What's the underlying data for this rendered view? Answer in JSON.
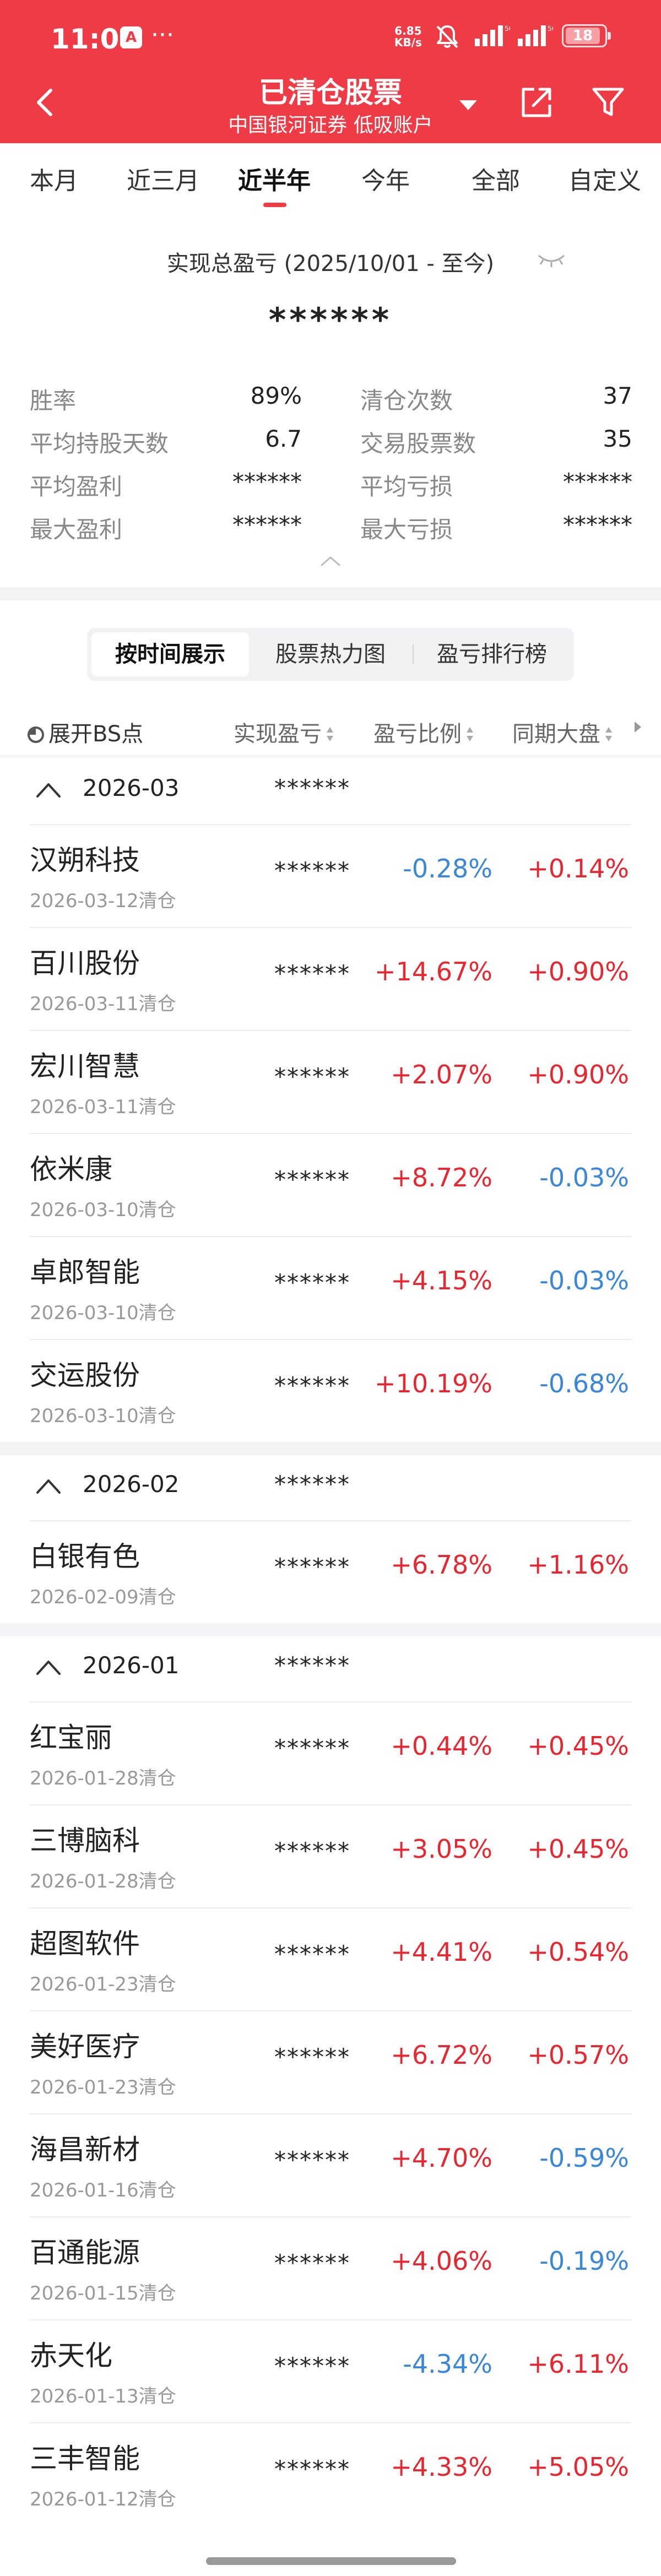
{
  "status_bar": {
    "time": "11:01",
    "net_speed": "6.85",
    "net_unit": "KB/s",
    "battery": "18",
    "nav_icon_label": "A",
    "more_dots": "···"
  },
  "header": {
    "title": "已清仓股票",
    "subtitle": "中国银河证券 低吸账户",
    "accent_color": "#ef3b45"
  },
  "tabs": [
    {
      "label": "本月"
    },
    {
      "label": "近三月"
    },
    {
      "label": "近半年"
    },
    {
      "label": "今年"
    },
    {
      "label": "全部"
    },
    {
      "label": "自定义"
    }
  ],
  "active_tab": "近半年",
  "summary": {
    "title": "实现总盈亏 (2025/10/01 - 至今)",
    "value": "******"
  },
  "stats": [
    {
      "label": "胜率",
      "value": "89%"
    },
    {
      "label": "清仓次数",
      "value": "37"
    },
    {
      "label": "平均持股天数",
      "value": "6.7"
    },
    {
      "label": "交易股票数",
      "value": "35"
    },
    {
      "label": "平均盈利",
      "value": "******"
    },
    {
      "label": "平均亏损",
      "value": "******"
    },
    {
      "label": "最大盈利",
      "value": "******"
    },
    {
      "label": "最大亏损",
      "value": "******"
    }
  ],
  "view_switch": {
    "items": [
      "按时间展示",
      "股票热力图",
      "盈亏排行榜"
    ],
    "active": "按时间展示"
  },
  "columns": {
    "expand": "展开BS点",
    "pnl": "实现盈亏",
    "pct": "盈亏比例",
    "bench": "同期大盘"
  },
  "colors": {
    "up": "#e8262f",
    "down": "#3a86d9"
  },
  "groups": [
    {
      "month": "2026-03",
      "value": "******",
      "rows": [
        {
          "name": "汉朔科技",
          "date": "2026-03-12清仓",
          "pnl": "******",
          "pct": "-0.28%",
          "bench": "+0.14%"
        },
        {
          "name": "百川股份",
          "date": "2026-03-11清仓",
          "pnl": "******",
          "pct": "+14.67%",
          "bench": "+0.90%"
        },
        {
          "name": "宏川智慧",
          "date": "2026-03-11清仓",
          "pnl": "******",
          "pct": "+2.07%",
          "bench": "+0.90%"
        },
        {
          "name": "依米康",
          "date": "2026-03-10清仓",
          "pnl": "******",
          "pct": "+8.72%",
          "bench": "-0.03%"
        },
        {
          "name": "卓郎智能",
          "date": "2026-03-10清仓",
          "pnl": "******",
          "pct": "+4.15%",
          "bench": "-0.03%"
        },
        {
          "name": "交运股份",
          "date": "2026-03-10清仓",
          "pnl": "******",
          "pct": "+10.19%",
          "bench": "-0.68%"
        }
      ]
    },
    {
      "month": "2026-02",
      "value": "******",
      "rows": [
        {
          "name": "白银有色",
          "date": "2026-02-09清仓",
          "pnl": "******",
          "pct": "+6.78%",
          "bench": "+1.16%"
        }
      ]
    },
    {
      "month": "2026-01",
      "value": "******",
      "rows": [
        {
          "name": "红宝丽",
          "date": "2026-01-28清仓",
          "pnl": "******",
          "pct": "+0.44%",
          "bench": "+0.45%"
        },
        {
          "name": "三博脑科",
          "date": "2026-01-28清仓",
          "pnl": "******",
          "pct": "+3.05%",
          "bench": "+0.45%"
        },
        {
          "name": "超图软件",
          "date": "2026-01-23清仓",
          "pnl": "******",
          "pct": "+4.41%",
          "bench": "+0.54%"
        },
        {
          "name": "美好医疗",
          "date": "2026-01-23清仓",
          "pnl": "******",
          "pct": "+6.72%",
          "bench": "+0.57%"
        },
        {
          "name": "海昌新材",
          "date": "2026-01-16清仓",
          "pnl": "******",
          "pct": "+4.70%",
          "bench": "-0.59%"
        },
        {
          "name": "百通能源",
          "date": "2026-01-15清仓",
          "pnl": "******",
          "pct": "+4.06%",
          "bench": "-0.19%"
        },
        {
          "name": "赤天化",
          "date": "2026-01-13清仓",
          "pnl": "******",
          "pct": "-4.34%",
          "bench": "+6.11%"
        },
        {
          "name": "三丰智能",
          "date": "2026-01-12清仓",
          "pnl": "******",
          "pct": "+4.33%",
          "bench": "+5.05%"
        }
      ]
    }
  ]
}
